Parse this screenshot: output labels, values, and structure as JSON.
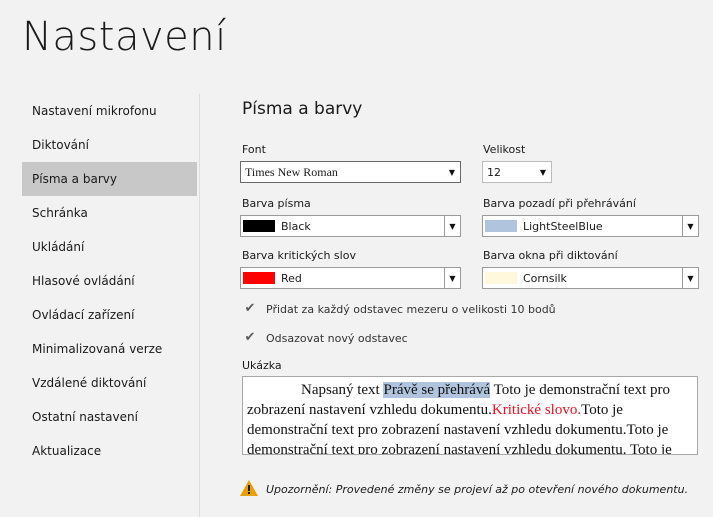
{
  "page_title": "Nastavení",
  "sidebar": {
    "items": [
      {
        "label": "Nastavení mikrofonu"
      },
      {
        "label": "Diktování"
      },
      {
        "label": "Písma a barvy"
      },
      {
        "label": "Schránka"
      },
      {
        "label": "Ukládání"
      },
      {
        "label": "Hlasové ovládání"
      },
      {
        "label": "Ovládací zařízení"
      },
      {
        "label": "Minimalizovaná verze"
      },
      {
        "label": "Vzdálené diktování"
      },
      {
        "label": "Ostatní nastavení"
      },
      {
        "label": "Aktualizace"
      }
    ],
    "active": "Písma a barvy"
  },
  "section_title": "Písma a barvy",
  "font": {
    "label": "Font",
    "value": "Times New Roman"
  },
  "size": {
    "label": "Velikost",
    "value": "12"
  },
  "font_color": {
    "label": "Barva písma",
    "value": "Black",
    "swatch": "#000000"
  },
  "playback_bg": {
    "label": "Barva pozadí při přehrávání",
    "value": "LightSteelBlue",
    "swatch": "#b0c4de"
  },
  "critical_color": {
    "label": "Barva kritických slov",
    "value": "Red",
    "swatch": "#ff0000"
  },
  "dictation_bg": {
    "label": "Barva okna při diktování",
    "value": "Cornsilk",
    "swatch": "#fff8dc"
  },
  "checkbox_spacing": {
    "label": "Přidat za každý odstavec mezeru o velikosti 10 bodů",
    "checked": true
  },
  "checkbox_indent": {
    "label": "Odsazovat nový odstavec",
    "checked": true
  },
  "preview": {
    "label": "Ukázka",
    "text_before": "Napsaný text ",
    "highlighted": "Právě se přehrává",
    "text_mid": " Toto je demonstrační text pro zobrazení nastavení vzhledu dokumentu.",
    "critical": "Kritické slovo.",
    "text_after": "Toto je demonstrační text pro zobrazení nastavení vzhledu dokumentu.Toto je demonstrační text pro zobrazení nastavení vzhledu dokumentu. Toto je demonstrační text pro zobrazení nastavení vzhledu dokumentu."
  },
  "warning": {
    "text": "Upozornění: Provedené změny se projeví až po otevření nového dokumentu.",
    "icon": "warning-icon",
    "color": "#e8a000"
  }
}
